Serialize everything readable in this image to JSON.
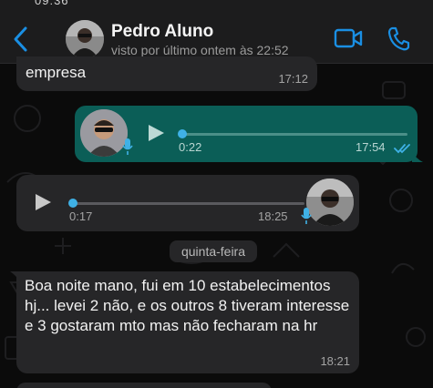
{
  "header": {
    "contact_name": "Pedro Aluno",
    "last_seen": "visto por último ontem às 22:52",
    "status_bar_stub": "09:36"
  },
  "icons": {
    "back": "chevron-left-icon",
    "video_call": "video-camera-icon",
    "voice_call": "phone-icon",
    "play": "play-icon",
    "mic": "microphone-icon",
    "read_receipt": "double-check-icon"
  },
  "colors": {
    "accent": "#1a8fe3",
    "outgoing_bubble": "#0b5e57",
    "incoming_bubble": "#262628",
    "progress_dot": "#3fb1e6"
  },
  "messages": [
    {
      "type": "text",
      "direction": "incoming",
      "text": "empresa",
      "time": "17:12"
    },
    {
      "type": "audio",
      "direction": "outgoing",
      "duration": "0:22",
      "time": "17:54",
      "played_fraction": 0.0,
      "read": true
    },
    {
      "type": "audio",
      "direction": "incoming",
      "duration": "0:17",
      "time": "18:25",
      "played_fraction": 0.0
    },
    {
      "type": "text",
      "direction": "incoming",
      "text": "Boa noite mano, fui em 10 estabelecimentos hj...  levei 2 não, e os outros 8 tiveram interesse e 3 gostaram mto mas não fecharam na hr",
      "time": "18:21"
    }
  ],
  "day_separator": "quinta-feira"
}
